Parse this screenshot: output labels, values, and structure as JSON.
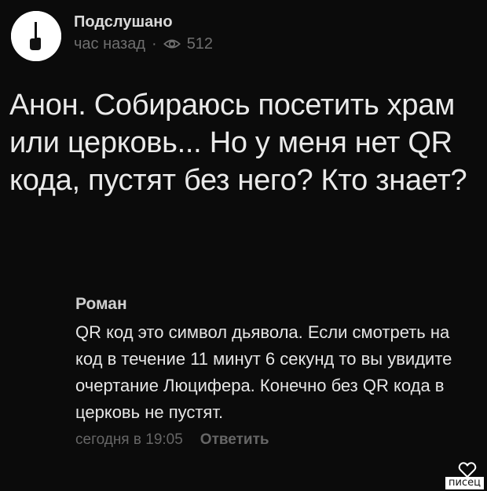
{
  "post": {
    "author": "Подслушано",
    "time": "час назад",
    "separator": "·",
    "views": "512",
    "text": "Анон. Собираюсь посетить храм или церковь... Но у меня нет QR кода, пустят без него? Кто знает?"
  },
  "comment": {
    "author": "Роман",
    "text": "QR код это символ дьявола. Если смотреть на код в течение 11 минут 6 секунд то вы увидите очертание Люцифера. Конечно без QR  кода в церковь не пустят.",
    "time": "сегодня в 19:05",
    "reply_label": "Ответить"
  },
  "icons": {
    "avatar": "avatar-image",
    "views": "eye-icon",
    "like": "heart-icon"
  },
  "watermark": "писец",
  "colors": {
    "background": "#0b0b0b",
    "text_primary": "#eaeaea",
    "text_secondary": "#6f6f6f"
  }
}
